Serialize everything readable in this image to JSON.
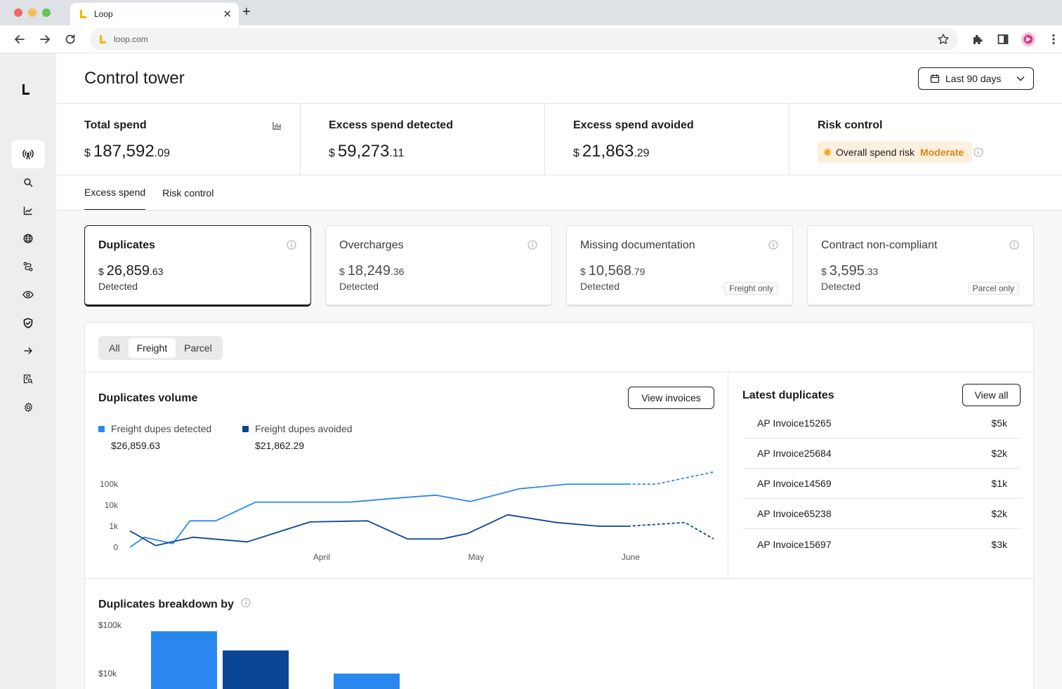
{
  "browser": {
    "tab_title": "Loop",
    "url": "loop.com"
  },
  "app": {
    "logo_letter": "L"
  },
  "sidebar": {
    "items": [
      {
        "icon": "broadcast-icon",
        "active": true
      },
      {
        "icon": "search-icon",
        "active": false
      },
      {
        "icon": "line-chart-icon",
        "active": false
      },
      {
        "icon": "globe-icon",
        "active": false
      },
      {
        "icon": "route-icon",
        "active": false
      },
      {
        "icon": "eye-icon",
        "active": false
      },
      {
        "icon": "shield-check-icon",
        "active": false
      },
      {
        "icon": "arrow-right-icon",
        "active": false
      },
      {
        "icon": "document-search-icon",
        "active": false
      },
      {
        "icon": "gear-icon",
        "active": false
      }
    ]
  },
  "header": {
    "title": "Control tower",
    "date_range": "Last 90 days"
  },
  "kpis": [
    {
      "title": "Total spend",
      "currency": "$",
      "int": "187,592",
      "dec": ".09"
    },
    {
      "title": "Excess spend detected",
      "currency": "$",
      "int": "59,273",
      "dec": ".11"
    },
    {
      "title": "Excess spend avoided",
      "currency": "$",
      "int": "21,863",
      "dec": ".29"
    },
    {
      "title": "Risk control",
      "risk_label": "Overall spend risk",
      "risk_level": "Moderate"
    }
  ],
  "tabs": [
    "Excess spend",
    "Risk control"
  ],
  "cards": [
    {
      "title": "Duplicates",
      "currency": "$",
      "int": "26,859",
      "dec": ".63",
      "sub": "Detected",
      "badge": ""
    },
    {
      "title": "Overcharges",
      "currency": "$",
      "int": "18,249",
      "dec": ".36",
      "sub": "Detected",
      "badge": ""
    },
    {
      "title": "Missing documentation",
      "currency": "$",
      "int": "10,568",
      "dec": ".79",
      "sub": "Detected",
      "badge": "Freight only"
    },
    {
      "title": "Contract non-compliant",
      "currency": "$",
      "int": "3,595",
      "dec": ".33",
      "sub": "Detected",
      "badge": "Parcel only"
    }
  ],
  "segments": [
    "All",
    "Freight",
    "Parcel"
  ],
  "volume": {
    "title": "Duplicates volume",
    "view_button": "View invoices",
    "legend": [
      {
        "name": "Freight dupes detected",
        "value": "$26,859.63",
        "color": "#2b87f0"
      },
      {
        "name": "Freight dupes avoided",
        "value": "$21,862.29",
        "color": "#0b4596"
      }
    ]
  },
  "chart_data": {
    "type": "line",
    "yscale": "log",
    "y_ticks": [
      "100k",
      "10k",
      "1k",
      "0"
    ],
    "x_ticks": [
      "April",
      "May",
      "June"
    ],
    "series": [
      {
        "name": "Freight dupes detected",
        "color": "#2b87f0",
        "x": [
          0,
          0.05,
          0.15,
          0.21,
          0.3,
          0.44,
          0.62,
          0.77,
          0.92,
          1.07,
          1.19,
          1.36,
          1.53,
          1.74
        ],
        "y": [
          1,
          300,
          150,
          1800,
          1800,
          14000,
          14000,
          14000,
          21000,
          30000,
          15000,
          60000,
          100000,
          100000
        ],
        "projected_x": [
          1.74,
          1.84,
          2.04
        ],
        "projected_y": [
          100000,
          100000,
          380000
        ]
      },
      {
        "name": "Freight dupes avoided",
        "color": "#0b4596",
        "x": [
          0,
          0.09,
          0.22,
          0.41,
          0.63,
          0.83,
          0.97,
          1.09,
          1.18,
          1.32,
          1.49,
          1.64,
          1.74
        ],
        "y": [
          600,
          120,
          300,
          180,
          1600,
          1800,
          250,
          250,
          450,
          3500,
          1500,
          1000,
          1000
        ],
        "projected_x": [
          1.74,
          1.94,
          2.04
        ],
        "projected_y": [
          1000,
          1500,
          250
        ]
      }
    ]
  },
  "latest": {
    "title": "Latest duplicates",
    "view_button": "View all",
    "rows": [
      {
        "name": "AP Invoice15265",
        "amount": "$5k"
      },
      {
        "name": "AP Invoice25684",
        "amount": "$2k"
      },
      {
        "name": "AP Invoice14569",
        "amount": "$1k"
      },
      {
        "name": "AP Invoice65238",
        "amount": "$2k"
      },
      {
        "name": "AP Invoice15697",
        "amount": "$3k"
      }
    ]
  },
  "breakdown": {
    "title": "Duplicates breakdown by",
    "y_ticks": [
      "$100k",
      "$10k"
    ],
    "bars": [
      {
        "value": 75000,
        "color": "#2b87f0"
      },
      {
        "value": 30000,
        "color": "#0b4596"
      },
      {
        "value": 10000,
        "color": "#2b87f0"
      }
    ]
  }
}
